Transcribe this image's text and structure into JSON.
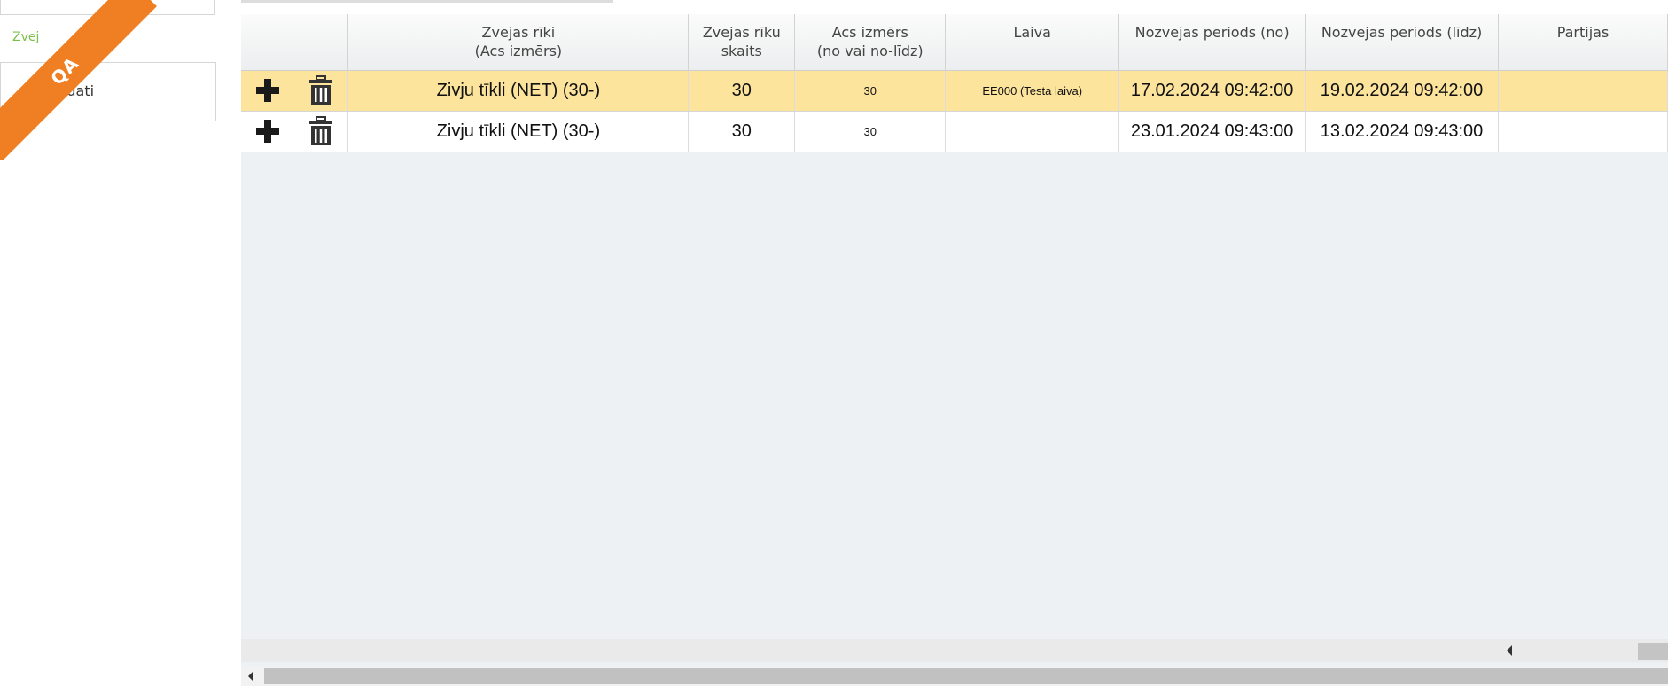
{
  "sidebar": {
    "tab_label": "Zvej",
    "item_label": "ie dati",
    "ribbon_label": "QA"
  },
  "colors": {
    "ribbon": "#ef7f22",
    "tab_text": "#7cc04a",
    "selected_row": "#fde49c"
  },
  "grid": {
    "columns": [
      {
        "key": "actions",
        "label": ""
      },
      {
        "key": "gear",
        "label": "Zvejas rīki\n(Acs izmērs)"
      },
      {
        "key": "count",
        "label": "Zvejas rīku\nskaits"
      },
      {
        "key": "mesh",
        "label": "Acs izmērs\n(no vai no-līdz)"
      },
      {
        "key": "boat",
        "label": "Laiva"
      },
      {
        "key": "from",
        "label": "Nozvejas periods (no)"
      },
      {
        "key": "to",
        "label": "Nozvejas periods (līdz)"
      },
      {
        "key": "batches",
        "label": "Partijas"
      }
    ],
    "rows": [
      {
        "gear": "Zivju tīkli (NET) (30-)",
        "count": "30",
        "mesh": "30",
        "boat": "EE000 (Testa laiva)",
        "from": "17.02.2024 09:42:00",
        "to": "19.02.2024 09:42:00",
        "batches": "",
        "selected": true
      },
      {
        "gear": "Zivju tīkli (NET) (30-)",
        "count": "30",
        "mesh": "30",
        "boat": "",
        "from": "23.01.2024 09:43:00",
        "to": "13.02.2024 09:43:00",
        "batches": "",
        "selected": false
      }
    ],
    "icons": {
      "add": "plus-icon",
      "delete": "trash-icon"
    }
  }
}
